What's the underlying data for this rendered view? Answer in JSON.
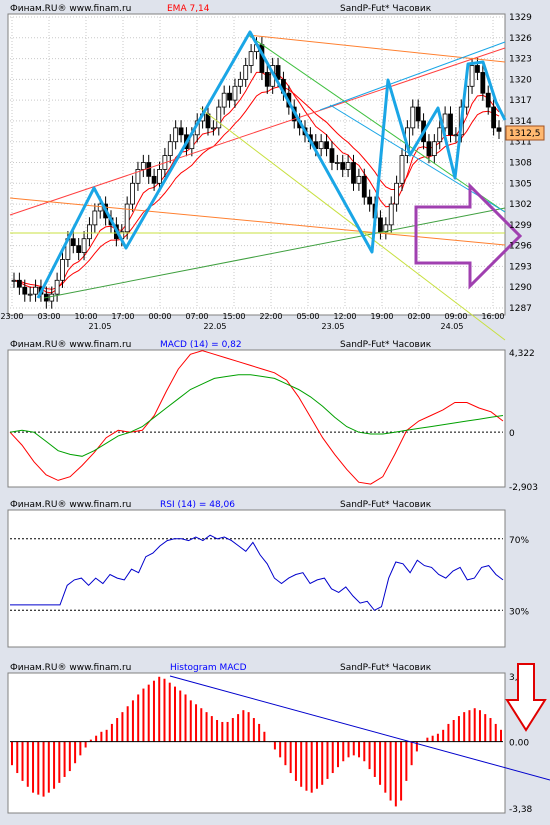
{
  "colors": {
    "panel_bg": "#ffffff",
    "outer_bg": "#dfe3ec",
    "grid": "#c9c9c9",
    "axis_text": "#000000",
    "title_red": "#ff0000",
    "title_blue": "#0000ff",
    "candle_up": "#ffffff",
    "candle_down": "#000000",
    "ema": "#ff0000",
    "trend_cyan": "#1aa6e6",
    "macd_red": "#ff0000",
    "macd_green": "#00a000",
    "rsi_blue": "#0000cc",
    "hist_red": "#ff0000",
    "hist_blue_line": "#0000cc",
    "purple_arrow": "#a040b0",
    "red_arrow": "#e00000",
    "price_tag_bg": "#ffb870"
  },
  "chart_data": [
    {
      "type": "candlestick",
      "panel": "price",
      "left_title": "Финам.RU® www.finam.ru",
      "indicator_label": "EMA 7,14",
      "right_title": "SandP-Fut* Часовик",
      "last_price_label": "1312,5",
      "y_ticks": [
        "1329",
        "1326",
        "1323",
        "1320",
        "1317",
        "1314",
        "1311",
        "1308",
        "1305",
        "1302",
        "1299",
        "1296",
        "1293",
        "1290",
        "1287"
      ],
      "ylim": [
        1287,
        1329
      ],
      "time_ticks": [
        "23:00",
        "03:00",
        "10:00",
        "17:00",
        "00:00",
        "07:00",
        "15:00",
        "22:00",
        "05:00",
        "12:00",
        "19:00",
        "02:00",
        "09:00",
        "16:00"
      ],
      "date_ticks": [
        "21.05",
        "22.05",
        "23.05",
        "24.05"
      ],
      "close": [
        1291,
        1290,
        1289,
        1289,
        1290,
        1289,
        1288,
        1289,
        1291,
        1294,
        1297,
        1296,
        1295,
        1297,
        1299,
        1301,
        1302,
        1300,
        1299,
        1297,
        1298,
        1302,
        1305,
        1307,
        1308,
        1306,
        1305,
        1307,
        1309,
        1311,
        1313,
        1312,
        1310,
        1312,
        1314,
        1315,
        1313,
        1313,
        1316,
        1318,
        1317,
        1319,
        1320,
        1322,
        1324,
        1325,
        1321,
        1319,
        1322,
        1320,
        1318,
        1316,
        1314,
        1313,
        1312,
        1311,
        1310,
        1311,
        1310,
        1308,
        1308,
        1307,
        1308,
        1305,
        1306,
        1303,
        1302,
        1300,
        1298,
        1299,
        1302,
        1305,
        1309,
        1313,
        1316,
        1314,
        1311,
        1309,
        1311,
        1313,
        1315,
        1312,
        1312,
        1316,
        1319,
        1322,
        1321,
        1318,
        1316,
        1313,
        1312.5
      ],
      "ema_fast": [
        1291,
        1290.7,
        1290.3,
        1290,
        1290,
        1289.8,
        1289.3,
        1289.2,
        1289.7,
        1290.8,
        1292.4,
        1293.3,
        1293.7,
        1294.5,
        1295.6,
        1296.9,
        1298.2,
        1298.7,
        1298.8,
        1298.3,
        1298.2,
        1299.2,
        1300.6,
        1302.2,
        1303.6,
        1304.2,
        1304.4,
        1305.1,
        1306.1,
        1307.3,
        1308.7,
        1309.5,
        1309.6,
        1310.2,
        1311.2,
        1312.1,
        1312.3,
        1312.5,
        1313.4,
        1314.6,
        1315.2,
        1316.1,
        1317.1,
        1318.3,
        1319.7,
        1321,
        1321,
        1320.5,
        1320.9,
        1320.7,
        1320,
        1319,
        1317.7,
        1316.6,
        1315.4,
        1314.3,
        1313.2,
        1312.6,
        1312,
        1311,
        1310.2,
        1309.4,
        1309.1,
        1308.1,
        1307.6,
        1306.4,
        1305.3,
        1304,
        1302.5,
        1301.6,
        1301.7,
        1302.5,
        1304.1,
        1306.3,
        1308.7,
        1310.1,
        1310.3,
        1310,
        1310.3,
        1310.9,
        1311.9,
        1311.9,
        1311.9,
        1313,
        1314.6,
        1316.5,
        1317.6,
        1317.7,
        1317.3,
        1316.2,
        1315.3
      ],
      "ema_slow": [
        1291,
        1290.9,
        1290.6,
        1290.4,
        1290.3,
        1290.1,
        1289.8,
        1289.7,
        1289.9,
        1290.5,
        1291.4,
        1292,
        1292.4,
        1293.1,
        1293.9,
        1294.9,
        1295.8,
        1296.4,
        1296.8,
        1296.8,
        1296.9,
        1297.6,
        1298.6,
        1299.7,
        1300.8,
        1301.5,
        1302,
        1302.7,
        1303.6,
        1304.6,
        1305.7,
        1306.5,
        1307,
        1307.6,
        1308.5,
        1309.3,
        1309.9,
        1310.3,
        1311.1,
        1312,
        1312.7,
        1313.6,
        1314.4,
        1315.4,
        1316.5,
        1317.6,
        1318.1,
        1318.2,
        1318.7,
        1318.9,
        1318.9,
        1318.5,
        1317.9,
        1317.2,
        1316.5,
        1315.8,
        1315,
        1314.4,
        1313.8,
        1313,
        1312.2,
        1311.5,
        1310.9,
        1310.1,
        1309.4,
        1308.5,
        1307.6,
        1306.6,
        1305.4,
        1304.5,
        1304.1,
        1304.1,
        1304.8,
        1306,
        1307.7,
        1308.5,
        1308.8,
        1308.8,
        1309.1,
        1309.6,
        1310.3,
        1310.6,
        1310.8,
        1311.5,
        1312.5,
        1313.8,
        1314.9,
        1315.3,
        1315.4,
        1315.1,
        1314.7
      ]
    },
    {
      "type": "line",
      "panel": "macd",
      "left_title": "Финам.RU® www.finam.ru",
      "indicator_label": "MACD (14) = 0,82",
      "right_title": "SandP-Fut* Часовик",
      "y_ticks": [
        "4,322",
        "0",
        "-2,903"
      ],
      "ylim": [
        -2.903,
        4.322
      ],
      "series": [
        {
          "color": "macd_red",
          "values": [
            0,
            -0.7,
            -1.6,
            -2.3,
            -2.6,
            -2.4,
            -1.8,
            -1.1,
            -0.3,
            0.1,
            0,
            0.1,
            0.9,
            2.2,
            3.4,
            4.2,
            4.4,
            4.2,
            4.0,
            3.8,
            3.6,
            3.4,
            3.2,
            2.8,
            1.9,
            0.8,
            -0.3,
            -1.2,
            -2.0,
            -2.7,
            -2.8,
            -2.4,
            -1.2,
            0.1,
            0.6,
            0.9,
            1.2,
            1.6,
            1.6,
            1.3,
            1.1,
            0.6
          ]
        },
        {
          "color": "macd_green",
          "values": [
            0,
            0.1,
            0,
            -0.5,
            -1.0,
            -1.2,
            -1.3,
            -1.0,
            -0.6,
            -0.2,
            0,
            0.3,
            0.8,
            1.3,
            1.8,
            2.3,
            2.6,
            2.9,
            3.0,
            3.1,
            3.1,
            3.0,
            2.9,
            2.6,
            2.3,
            1.9,
            1.4,
            0.8,
            0.3,
            0,
            -0.1,
            -0.1,
            0,
            0.1,
            0.2,
            0.3,
            0.4,
            0.5,
            0.6,
            0.7,
            0.8,
            0.9
          ]
        }
      ]
    },
    {
      "type": "line",
      "panel": "rsi",
      "left_title": "Финам.RU® www.finam.ru",
      "indicator_label": "RSI (14) = 48,06",
      "right_title": "SandP-Fut* Часовик",
      "y_ticks": [
        "70%",
        "30%"
      ],
      "levels": [
        70,
        30
      ],
      "ylim": [
        10,
        85
      ],
      "values": [
        33,
        33,
        33,
        33,
        33,
        33,
        33,
        33,
        44,
        47,
        48,
        44,
        48,
        45,
        50,
        48,
        47,
        53,
        51,
        60,
        62,
        66,
        69,
        70,
        70,
        69,
        71,
        69,
        72,
        70,
        71,
        69,
        66,
        63,
        68,
        61,
        56,
        48,
        45,
        48,
        50,
        51,
        45,
        47,
        48,
        42,
        40,
        43,
        38,
        34,
        35,
        30,
        32,
        48,
        57,
        56,
        51,
        58,
        55,
        54,
        50,
        48,
        52,
        54,
        47,
        48,
        54,
        55,
        50,
        47
      ]
    },
    {
      "type": "bar",
      "panel": "histogram",
      "left_title": "Финам.RU® www.finam.ru",
      "indicator_label": "Histogram MACD",
      "right_title": "SandP-Fut* Часовик",
      "y_ticks": [
        "3,34",
        "0.00",
        "-3,38"
      ],
      "ylim": [
        -3.38,
        3.34
      ],
      "values": [
        -1.2,
        -1.6,
        -2.0,
        -2.3,
        -2.6,
        -2.7,
        -2.8,
        -2.6,
        -2.4,
        -2.1,
        -1.8,
        -1.5,
        -1.1,
        -0.7,
        -0.3,
        0.1,
        0.3,
        0.5,
        0.6,
        0.9,
        1.2,
        1.5,
        1.8,
        2.1,
        2.4,
        2.7,
        2.9,
        3.1,
        3.3,
        3.2,
        3.0,
        2.8,
        2.6,
        2.4,
        2.1,
        1.9,
        1.7,
        1.5,
        1.3,
        1.1,
        1.0,
        1.0,
        1.2,
        1.4,
        1.6,
        1.5,
        1.2,
        0.9,
        0.5,
        0,
        -0.4,
        -0.8,
        -1.2,
        -1.6,
        -2.0,
        -2.3,
        -2.5,
        -2.6,
        -2.4,
        -2.2,
        -1.9,
        -1.6,
        -1.3,
        -1.0,
        -0.8,
        -0.7,
        -0.8,
        -1.0,
        -1.4,
        -1.8,
        -2.2,
        -2.6,
        -3.0,
        -3.3,
        -3.0,
        -2.0,
        -1.2,
        -0.5,
        0,
        0.2,
        0.3,
        0.4,
        0.6,
        0.9,
        1.1,
        1.3,
        1.5,
        1.6,
        1.7,
        1.6,
        1.4,
        1.2,
        0.9,
        0.6
      ]
    }
  ]
}
